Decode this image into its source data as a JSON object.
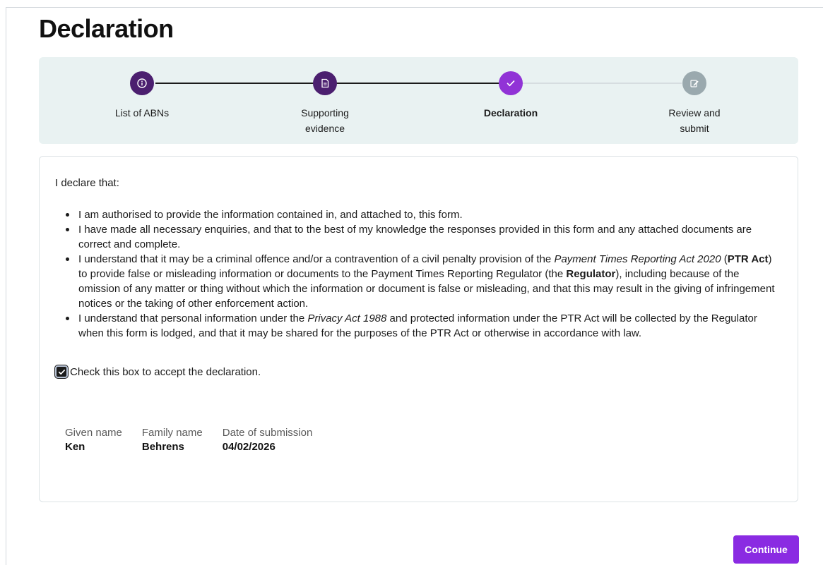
{
  "page": {
    "title": "Declaration"
  },
  "stepper": {
    "steps": [
      {
        "label": "List of ABNs",
        "icon": "info-icon",
        "state": "complete"
      },
      {
        "label_line1": "Supporting",
        "label_line2": "evidence",
        "icon": "document-icon",
        "state": "complete"
      },
      {
        "label": "Declaration",
        "icon": "check-icon",
        "state": "current"
      },
      {
        "label_line1": "Review and",
        "label_line2": "submit",
        "icon": "edit-icon",
        "state": "upcoming"
      }
    ]
  },
  "declaration": {
    "intro": "I declare that:",
    "b1": "I am authorised to provide the information contained in, and attached to, this form.",
    "b2": "I have made all necessary enquiries, and that to the best of my knowledge the responses provided in this form and any attached documents are correct and complete.",
    "b3_a": "I understand that it may be a criminal offence and/or a contravention of a civil penalty provision of the ",
    "b3_act": "Payment Times Reporting Act 2020",
    "b3_b": " (",
    "b3_ptr": "PTR Act",
    "b3_c": ") to provide false or misleading information or documents to the Payment Times Reporting Regulator (the ",
    "b3_reg": "Regulator",
    "b3_d": "), including because of the omission of any matter or thing without which the information or document is false or misleading, and that this may result in the giving of infringement notices or the taking of other enforcement action.",
    "b4_a": "I understand that personal information under the ",
    "b4_act": "Privacy Act 1988",
    "b4_b": " and protected information under the PTR Act will be collected by the Regulator when this form is lodged, and that it may be shared for the purposes of the PTR Act or otherwise in accordance with law.",
    "checkbox_label": "Check this box to accept the declaration.",
    "checkbox_checked": true
  },
  "details": {
    "given_name_label": "Given name",
    "given_name": "Ken",
    "family_name_label": "Family name",
    "family_name": "Behrens",
    "date_label": "Date of submission",
    "date": "04/02/2026"
  },
  "actions": {
    "continue_label": "Continue"
  },
  "colors": {
    "accent": "#8a2be2",
    "step_complete": "#4b1f6f",
    "step_current": "#9133d6",
    "step_upcoming": "#9aa9ae",
    "stepper_bg": "#e9f2f2"
  }
}
